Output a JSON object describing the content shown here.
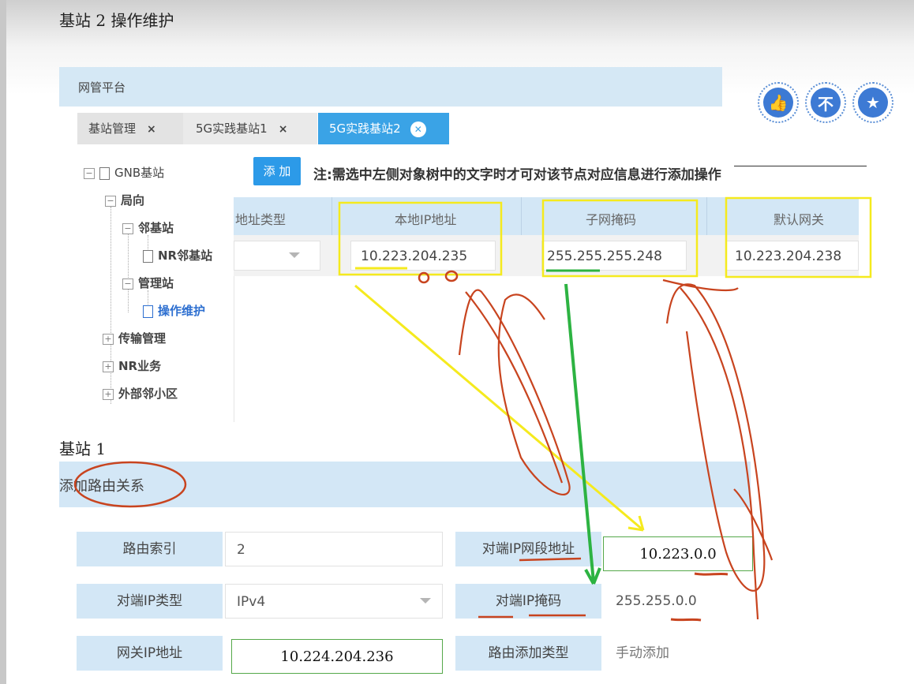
{
  "doc": {
    "title": "基站 2  操作维护",
    "section1_title": "基站 1"
  },
  "network_platform": {
    "header": "网管平台",
    "tabs": [
      {
        "label": "基站管理",
        "close": "×",
        "active": false
      },
      {
        "label": "5G实践基站1",
        "close": "×",
        "active": false
      },
      {
        "label": "5G实践基站2",
        "close": "×",
        "active": true
      }
    ],
    "tree": {
      "root": "GNB基站",
      "items": [
        "局向",
        "邻基站",
        "NR邻基站",
        "管理站",
        "操作维护",
        "传输管理",
        "NR业务",
        "外部邻小区"
      ],
      "selected": "操作维护"
    },
    "add_button": "添 加",
    "note": "注:需选中左侧对象树中的文字时才可对该节点对应信息进行添加操作",
    "grid": {
      "columns": [
        "地址类型",
        "本地IP地址",
        "子网掩码",
        "默认网关"
      ],
      "row": {
        "address_type": "",
        "local_ip": "10.223.204.235",
        "subnet_mask": "255.255.255.248",
        "gateway": "10.223.204.238"
      }
    }
  },
  "route_form": {
    "header": "添加路由关系",
    "fields": {
      "route_index_label": "路由索引",
      "route_index_value": "2",
      "peer_ip_type_label": "对端IP类型",
      "peer_ip_type_value": "IPv4",
      "gateway_ip_label": "网关IP地址",
      "gateway_ip_value": "10.224.204.236",
      "peer_ip_segment_label": "对端IP网段地址",
      "peer_ip_segment_value": "10.223.0.0",
      "peer_ip_mask_label": "对端IP掩码",
      "peer_ip_mask_value": "255.255.0.0",
      "route_add_type_label": "路由添加类型",
      "route_add_type_value": "手动添加"
    }
  },
  "reactions": [
    {
      "icon": "thumbs-up-icon",
      "glyph": "👍"
    },
    {
      "icon": "not-icon",
      "glyph": "不"
    },
    {
      "icon": "star-icon",
      "glyph": "★"
    }
  ],
  "colors": {
    "accent_blue": "#2c9ae8",
    "header_blue": "#d3e7f6",
    "highlight_yellow": "#f5ea1e",
    "annotation_green": "#2db342",
    "annotation_red": "#c8441f"
  }
}
